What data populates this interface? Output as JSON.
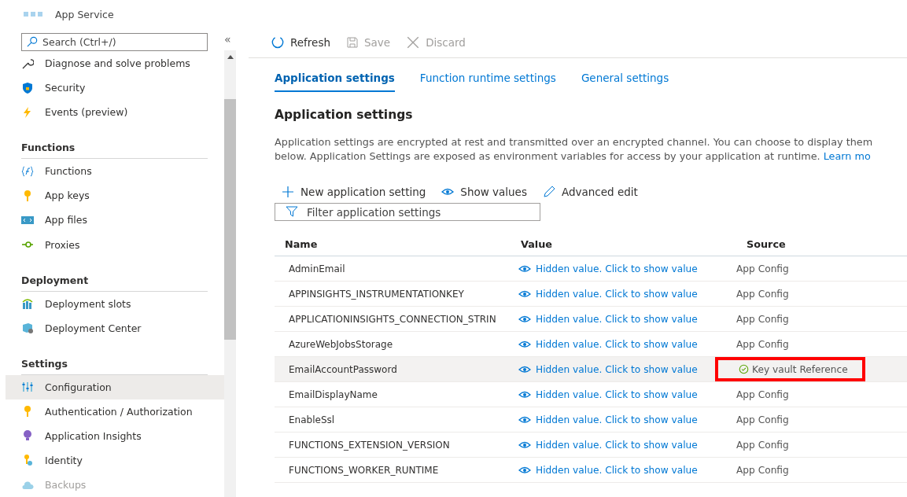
{
  "header": {
    "title": "App Service"
  },
  "sidebar": {
    "search": {
      "placeholder": "Search (Ctrl+/)"
    },
    "collapse": "«",
    "sections": [
      {
        "items": [
          {
            "label": "Diagnose and solve problems",
            "selected": false,
            "disabled": false
          },
          {
            "label": "Security",
            "selected": false,
            "disabled": false
          },
          {
            "label": "Events (preview)",
            "selected": false,
            "disabled": false
          }
        ]
      },
      {
        "heading": "Functions",
        "items": [
          {
            "label": "Functions",
            "selected": false,
            "disabled": false
          },
          {
            "label": "App keys",
            "selected": false,
            "disabled": false
          },
          {
            "label": "App files",
            "selected": false,
            "disabled": false
          },
          {
            "label": "Proxies",
            "selected": false,
            "disabled": false
          }
        ]
      },
      {
        "heading": "Deployment",
        "items": [
          {
            "label": "Deployment slots",
            "selected": false,
            "disabled": false
          },
          {
            "label": "Deployment Center",
            "selected": false,
            "disabled": false
          }
        ]
      },
      {
        "heading": "Settings",
        "items": [
          {
            "label": "Configuration",
            "selected": true,
            "disabled": false
          },
          {
            "label": "Authentication / Authorization",
            "selected": false,
            "disabled": false
          },
          {
            "label": "Application Insights",
            "selected": false,
            "disabled": false
          },
          {
            "label": "Identity",
            "selected": false,
            "disabled": false
          },
          {
            "label": "Backups",
            "selected": false,
            "disabled": true
          }
        ]
      }
    ]
  },
  "toolbar": [
    {
      "label": "Refresh",
      "disabled": false
    },
    {
      "label": "Save",
      "disabled": true
    },
    {
      "label": "Discard",
      "disabled": true
    }
  ],
  "tabs": [
    {
      "label": "Application settings",
      "selected": true
    },
    {
      "label": "Function runtime settings",
      "selected": false
    },
    {
      "label": "General settings",
      "selected": false
    }
  ],
  "section": {
    "title": "Application settings",
    "description": {
      "lines": [
        "Application settings are encrypted at rest and transmitted over an encrypted channel. You can choose to display them",
        "below. Application Settings are exposed as environment variables for access by your application at runtime."
      ],
      "link": "Learn mo"
    }
  },
  "commands": [
    "New application setting",
    "Show values",
    "Advanced edit"
  ],
  "filter": {
    "placeholder": "Filter application settings"
  },
  "table": {
    "columns": [
      "Name",
      "Value",
      "Source"
    ],
    "rows": [
      {
        "name": "AdminEmail",
        "value": "Hidden value. Click to show value",
        "source": "App Config",
        "kind": "config",
        "hovered": false,
        "highlighted": false
      },
      {
        "name": "APPINSIGHTS_INSTRUMENTATIONKEY",
        "value": "Hidden value. Click to show value",
        "source": "App Config",
        "kind": "config",
        "hovered": false,
        "highlighted": false
      },
      {
        "name": "APPLICATIONINSIGHTS_CONNECTION_STRIN",
        "value": "Hidden value. Click to show value",
        "source": "App Config",
        "kind": "config",
        "hovered": false,
        "highlighted": false
      },
      {
        "name": "AzureWebJobsStorage",
        "value": "Hidden value. Click to show value",
        "source": "App Config",
        "kind": "config",
        "hovered": false,
        "highlighted": false
      },
      {
        "name": "EmailAccountPassword",
        "value": "Hidden value. Click to show value",
        "source": "Key vault Reference",
        "kind": "keyvault",
        "hovered": true,
        "highlighted": true
      },
      {
        "name": "EmailDisplayName",
        "value": "Hidden value. Click to show value",
        "source": "App Config",
        "kind": "config",
        "hovered": false,
        "highlighted": false
      },
      {
        "name": "EnableSsl",
        "value": "Hidden value. Click to show value",
        "source": "App Config",
        "kind": "config",
        "hovered": false,
        "highlighted": false
      },
      {
        "name": "FUNCTIONS_EXTENSION_VERSION",
        "value": "Hidden value. Click to show value",
        "source": "App Config",
        "kind": "config",
        "hovered": false,
        "highlighted": false
      },
      {
        "name": "FUNCTIONS_WORKER_RUNTIME",
        "value": "Hidden value. Click to show value",
        "source": "App Config",
        "kind": "config",
        "hovered": false,
        "highlighted": false
      }
    ]
  }
}
